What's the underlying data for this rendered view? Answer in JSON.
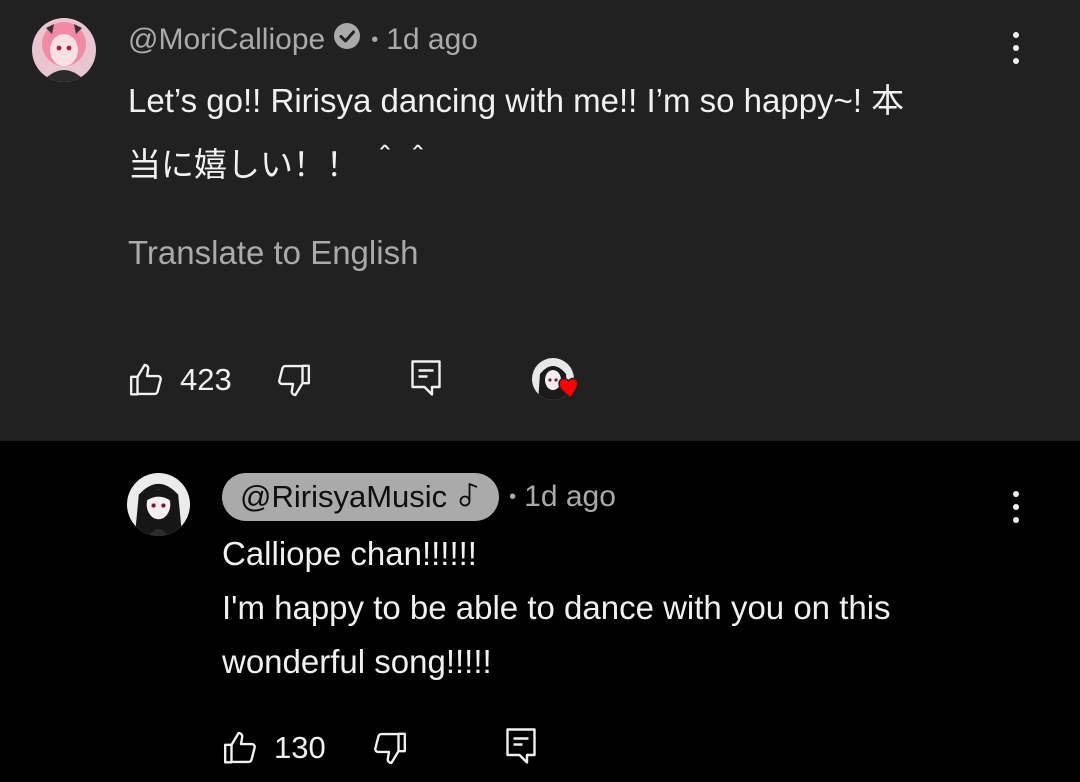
{
  "top_comment": {
    "author": "@MoriCalliope",
    "time": "1d ago",
    "text_line1": "Let’s go!! Ririsya dancing with me!! I’m so happy~! 本",
    "text_line2": "当に嬉しい！！ ＾＾",
    "translate_label": "Translate to English",
    "likes": "423",
    "icons": {
      "verified": "verified-check-icon",
      "like": "thumb-up-icon",
      "dislike": "thumb-down-icon",
      "reply": "reply-icon",
      "more": "more-vertical-icon",
      "creator_heart": "creator-heart-icon"
    }
  },
  "reply": {
    "author": "@RirisyaMusic",
    "time": "1d ago",
    "lines": [
      "Calliope chan!!!!!!",
      "I'm happy to be able to dance with you on this",
      "wonderful song!!!!!"
    ],
    "likes": "130",
    "icons": {
      "music_note": "music-note-icon",
      "like": "thumb-up-icon",
      "dislike": "thumb-down-icon",
      "reply": "reply-icon",
      "more": "more-vertical-icon"
    }
  },
  "colors": {
    "top_background": "#212121",
    "reply_background": "#000000",
    "text_primary": "#f1f1f1",
    "text_secondary": "#aaaaaa",
    "heart": "#ff0000"
  }
}
